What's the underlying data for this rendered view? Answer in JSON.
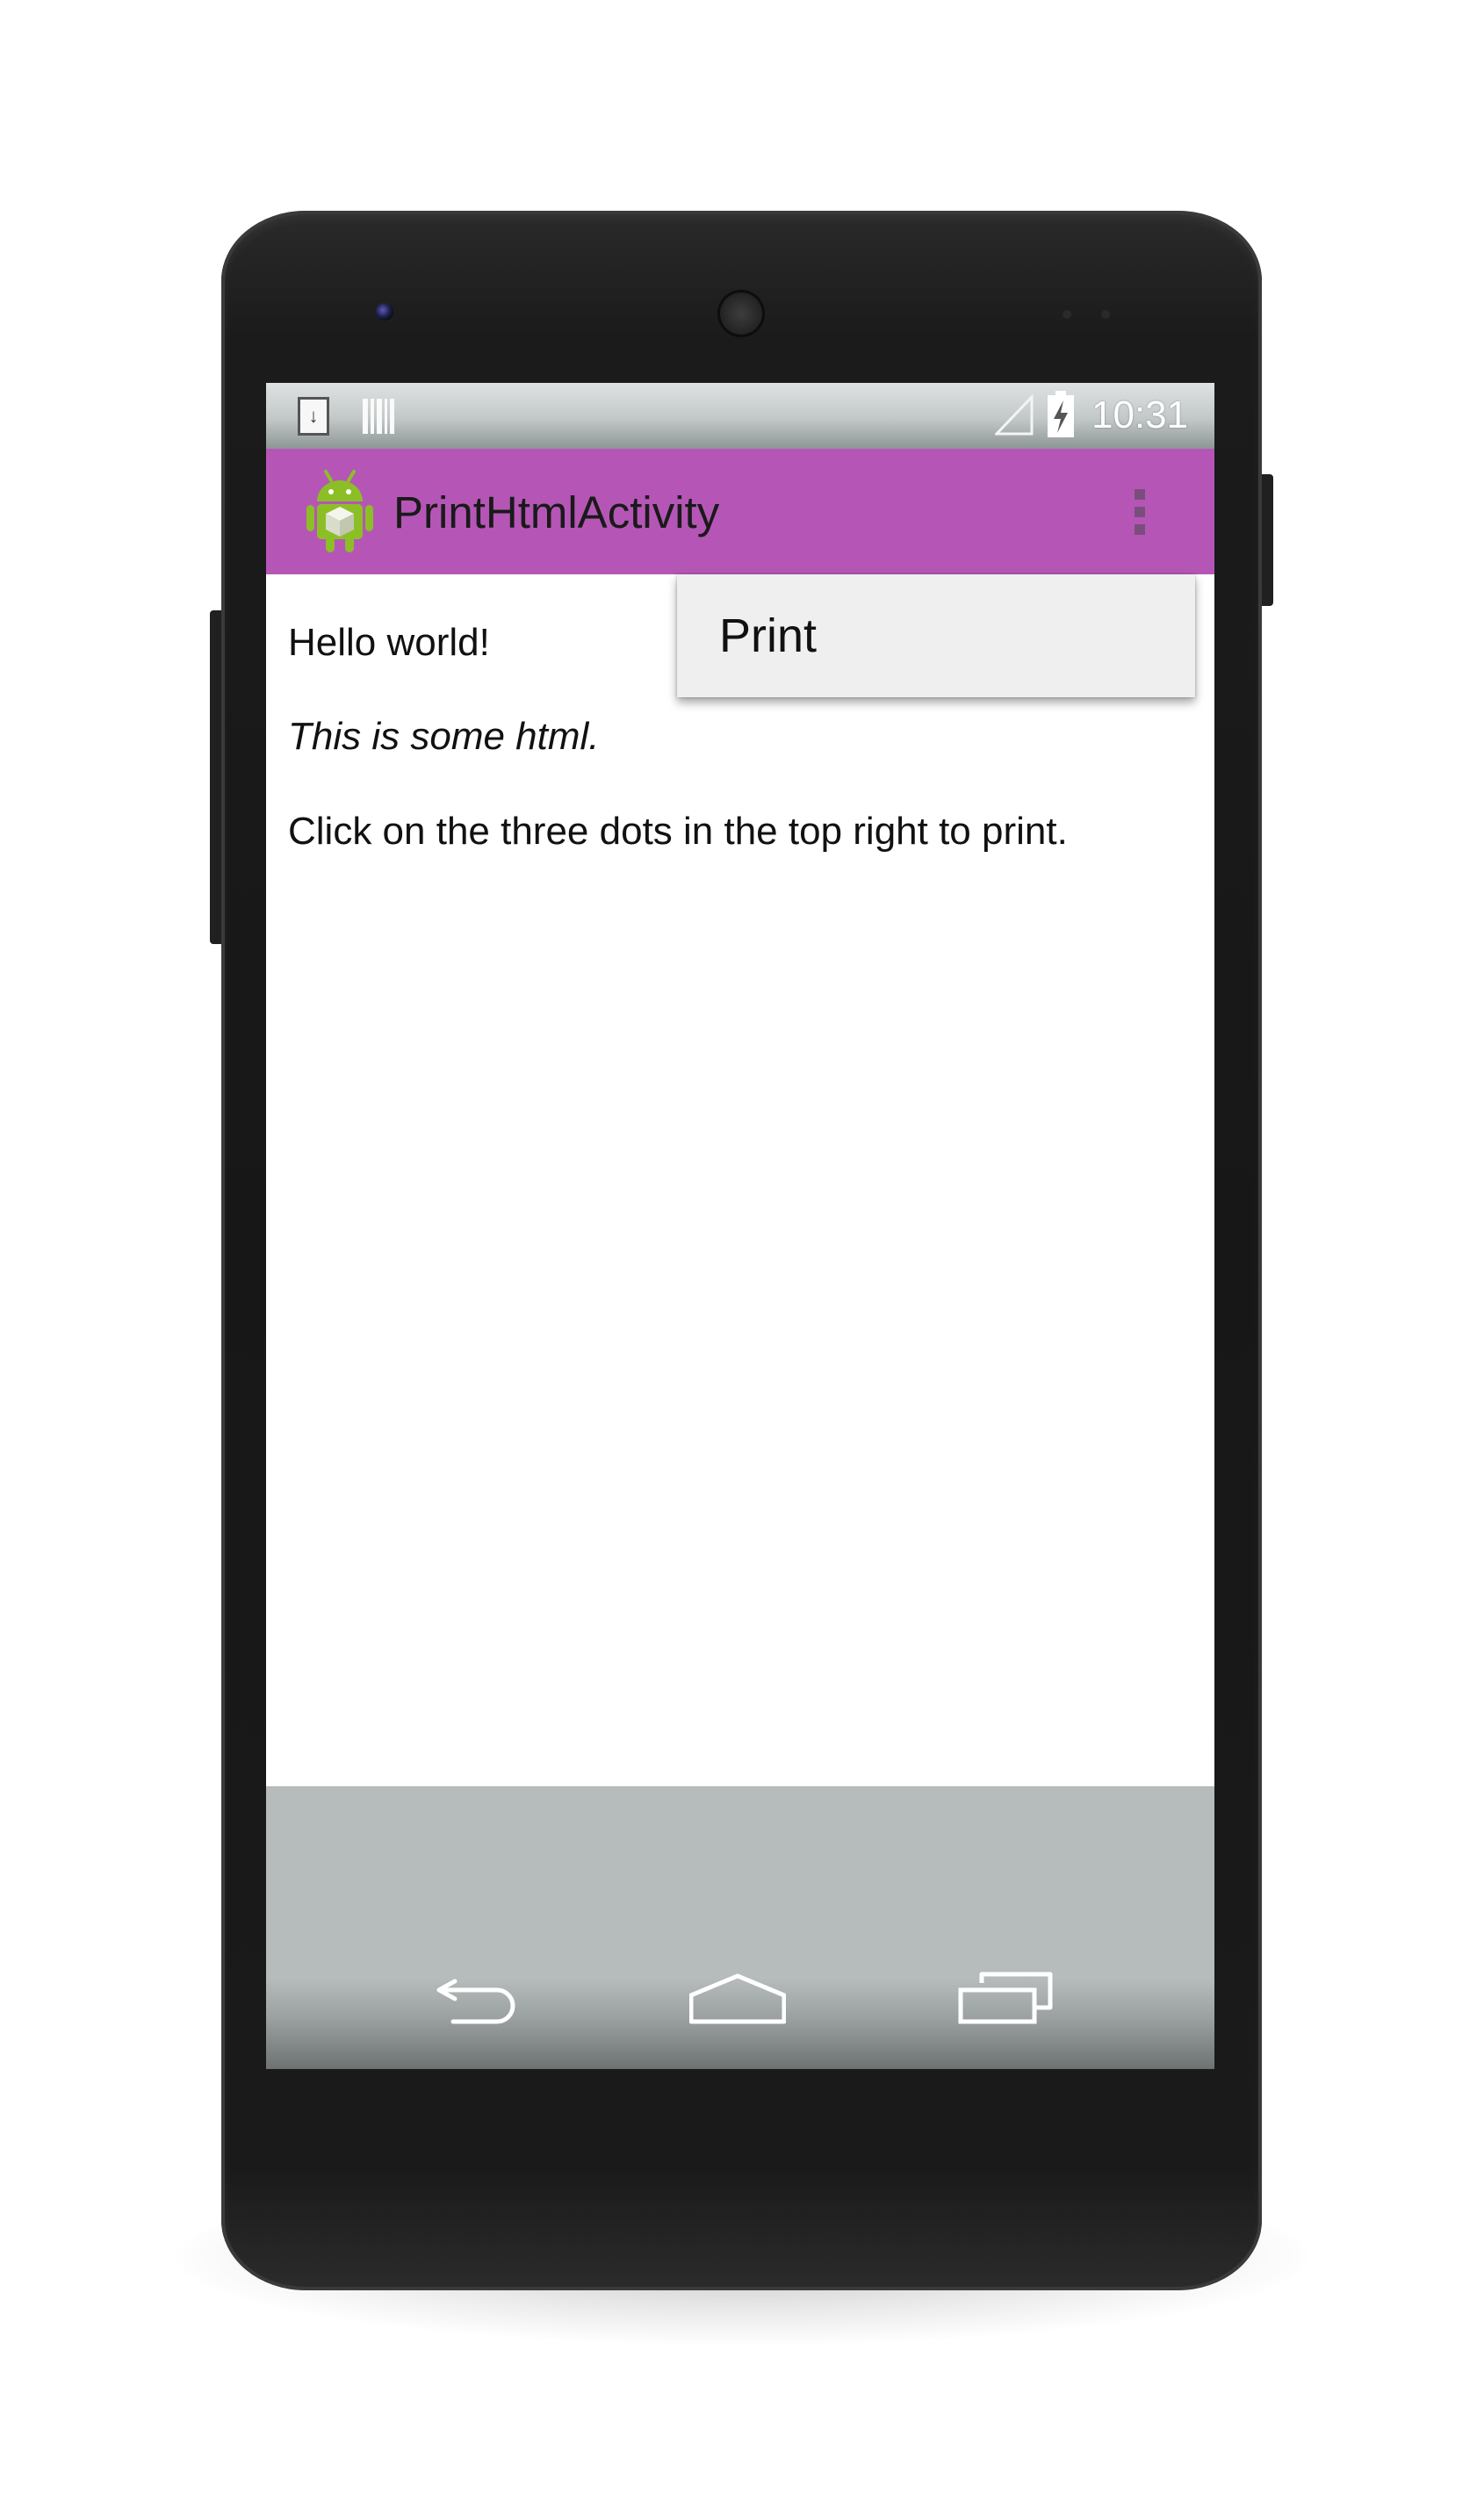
{
  "status_bar": {
    "time": "10:31",
    "icons": [
      "download-notification-icon",
      "barcode-notification-icon",
      "signal-icon",
      "battery-charging-icon"
    ]
  },
  "action_bar": {
    "app_icon": "android-robot-icon",
    "title": "PrintHtmlActivity",
    "overflow_icon": "three-dots-vertical-icon",
    "background_color": "#b556b6"
  },
  "overflow_menu": {
    "items": [
      {
        "label": "Print"
      }
    ]
  },
  "content": {
    "lines": [
      "Hello world!",
      "This is some html.",
      "Click on the three dots in the top right to print."
    ]
  },
  "nav_bar": {
    "icons": [
      "back-icon",
      "home-icon",
      "recent-apps-icon"
    ]
  }
}
